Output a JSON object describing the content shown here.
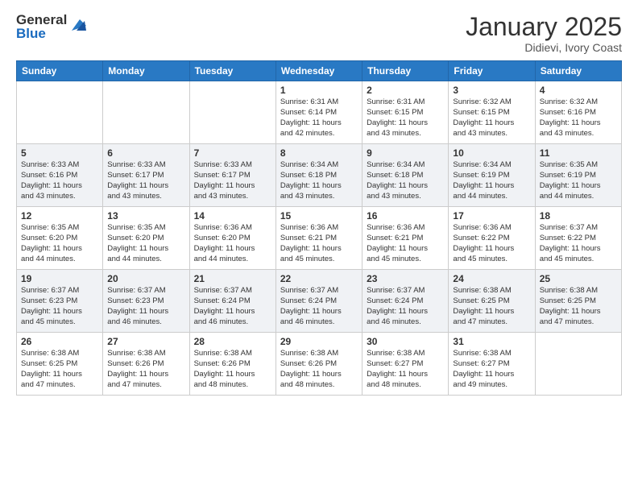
{
  "header": {
    "logo_general": "General",
    "logo_blue": "Blue",
    "month_title": "January 2025",
    "location": "Didievi, Ivory Coast"
  },
  "days_of_week": [
    "Sunday",
    "Monday",
    "Tuesday",
    "Wednesday",
    "Thursday",
    "Friday",
    "Saturday"
  ],
  "weeks": [
    [
      {
        "day": "",
        "info": ""
      },
      {
        "day": "",
        "info": ""
      },
      {
        "day": "",
        "info": ""
      },
      {
        "day": "1",
        "info": "Sunrise: 6:31 AM\nSunset: 6:14 PM\nDaylight: 11 hours\nand 42 minutes."
      },
      {
        "day": "2",
        "info": "Sunrise: 6:31 AM\nSunset: 6:15 PM\nDaylight: 11 hours\nand 43 minutes."
      },
      {
        "day": "3",
        "info": "Sunrise: 6:32 AM\nSunset: 6:15 PM\nDaylight: 11 hours\nand 43 minutes."
      },
      {
        "day": "4",
        "info": "Sunrise: 6:32 AM\nSunset: 6:16 PM\nDaylight: 11 hours\nand 43 minutes."
      }
    ],
    [
      {
        "day": "5",
        "info": "Sunrise: 6:33 AM\nSunset: 6:16 PM\nDaylight: 11 hours\nand 43 minutes."
      },
      {
        "day": "6",
        "info": "Sunrise: 6:33 AM\nSunset: 6:17 PM\nDaylight: 11 hours\nand 43 minutes."
      },
      {
        "day": "7",
        "info": "Sunrise: 6:33 AM\nSunset: 6:17 PM\nDaylight: 11 hours\nand 43 minutes."
      },
      {
        "day": "8",
        "info": "Sunrise: 6:34 AM\nSunset: 6:18 PM\nDaylight: 11 hours\nand 43 minutes."
      },
      {
        "day": "9",
        "info": "Sunrise: 6:34 AM\nSunset: 6:18 PM\nDaylight: 11 hours\nand 43 minutes."
      },
      {
        "day": "10",
        "info": "Sunrise: 6:34 AM\nSunset: 6:19 PM\nDaylight: 11 hours\nand 44 minutes."
      },
      {
        "day": "11",
        "info": "Sunrise: 6:35 AM\nSunset: 6:19 PM\nDaylight: 11 hours\nand 44 minutes."
      }
    ],
    [
      {
        "day": "12",
        "info": "Sunrise: 6:35 AM\nSunset: 6:20 PM\nDaylight: 11 hours\nand 44 minutes."
      },
      {
        "day": "13",
        "info": "Sunrise: 6:35 AM\nSunset: 6:20 PM\nDaylight: 11 hours\nand 44 minutes."
      },
      {
        "day": "14",
        "info": "Sunrise: 6:36 AM\nSunset: 6:20 PM\nDaylight: 11 hours\nand 44 minutes."
      },
      {
        "day": "15",
        "info": "Sunrise: 6:36 AM\nSunset: 6:21 PM\nDaylight: 11 hours\nand 45 minutes."
      },
      {
        "day": "16",
        "info": "Sunrise: 6:36 AM\nSunset: 6:21 PM\nDaylight: 11 hours\nand 45 minutes."
      },
      {
        "day": "17",
        "info": "Sunrise: 6:36 AM\nSunset: 6:22 PM\nDaylight: 11 hours\nand 45 minutes."
      },
      {
        "day": "18",
        "info": "Sunrise: 6:37 AM\nSunset: 6:22 PM\nDaylight: 11 hours\nand 45 minutes."
      }
    ],
    [
      {
        "day": "19",
        "info": "Sunrise: 6:37 AM\nSunset: 6:23 PM\nDaylight: 11 hours\nand 45 minutes."
      },
      {
        "day": "20",
        "info": "Sunrise: 6:37 AM\nSunset: 6:23 PM\nDaylight: 11 hours\nand 46 minutes."
      },
      {
        "day": "21",
        "info": "Sunrise: 6:37 AM\nSunset: 6:24 PM\nDaylight: 11 hours\nand 46 minutes."
      },
      {
        "day": "22",
        "info": "Sunrise: 6:37 AM\nSunset: 6:24 PM\nDaylight: 11 hours\nand 46 minutes."
      },
      {
        "day": "23",
        "info": "Sunrise: 6:37 AM\nSunset: 6:24 PM\nDaylight: 11 hours\nand 46 minutes."
      },
      {
        "day": "24",
        "info": "Sunrise: 6:38 AM\nSunset: 6:25 PM\nDaylight: 11 hours\nand 47 minutes."
      },
      {
        "day": "25",
        "info": "Sunrise: 6:38 AM\nSunset: 6:25 PM\nDaylight: 11 hours\nand 47 minutes."
      }
    ],
    [
      {
        "day": "26",
        "info": "Sunrise: 6:38 AM\nSunset: 6:25 PM\nDaylight: 11 hours\nand 47 minutes."
      },
      {
        "day": "27",
        "info": "Sunrise: 6:38 AM\nSunset: 6:26 PM\nDaylight: 11 hours\nand 47 minutes."
      },
      {
        "day": "28",
        "info": "Sunrise: 6:38 AM\nSunset: 6:26 PM\nDaylight: 11 hours\nand 48 minutes."
      },
      {
        "day": "29",
        "info": "Sunrise: 6:38 AM\nSunset: 6:26 PM\nDaylight: 11 hours\nand 48 minutes."
      },
      {
        "day": "30",
        "info": "Sunrise: 6:38 AM\nSunset: 6:27 PM\nDaylight: 11 hours\nand 48 minutes."
      },
      {
        "day": "31",
        "info": "Sunrise: 6:38 AM\nSunset: 6:27 PM\nDaylight: 11 hours\nand 49 minutes."
      },
      {
        "day": "",
        "info": ""
      }
    ]
  ]
}
